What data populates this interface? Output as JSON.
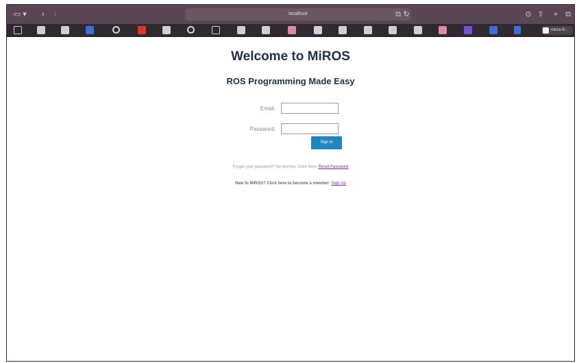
{
  "browser": {
    "address": "localhost",
    "last_tab": "miros-fr..."
  },
  "page": {
    "title": "Welcome to MiROS",
    "subtitle": "ROS Programming Made Easy",
    "email_label": "Email:",
    "password_label": "Password:",
    "email_value": "",
    "password_value": "",
    "signin_label": "Sign in",
    "forgot_text": "Forgot your password? No worries. Click here:",
    "reset_link": "Reset Password",
    "new_text": "New to MiROS? Click here to become a member:",
    "signup_link": "Sign Up"
  },
  "colors": {
    "toolbar": "#5b4655",
    "title": "#23324a",
    "button": "#1f86c6",
    "link": "#6c32c2"
  }
}
